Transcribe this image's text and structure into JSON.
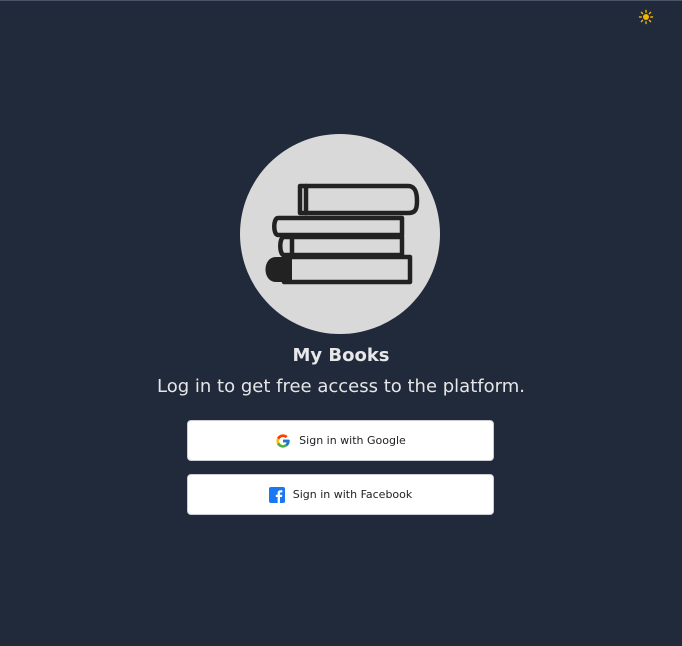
{
  "app": {
    "title": "My Books",
    "subtitle": "Log in to get free access to the platform."
  },
  "header": {
    "theme_toggle_icon": "sun-icon",
    "theme_toggle_color": "#f5b301"
  },
  "logo": {
    "icon": "stack-of-books-icon",
    "background": "#d9d9d9",
    "ink": "#222222"
  },
  "auth": {
    "google": {
      "label": "Sign in with Google",
      "icon": "google-icon"
    },
    "facebook": {
      "label": "Sign in with Facebook",
      "icon": "facebook-icon"
    }
  },
  "colors": {
    "background": "#212a3a",
    "button_background": "#ffffff",
    "facebook_blue": "#1877f2"
  }
}
